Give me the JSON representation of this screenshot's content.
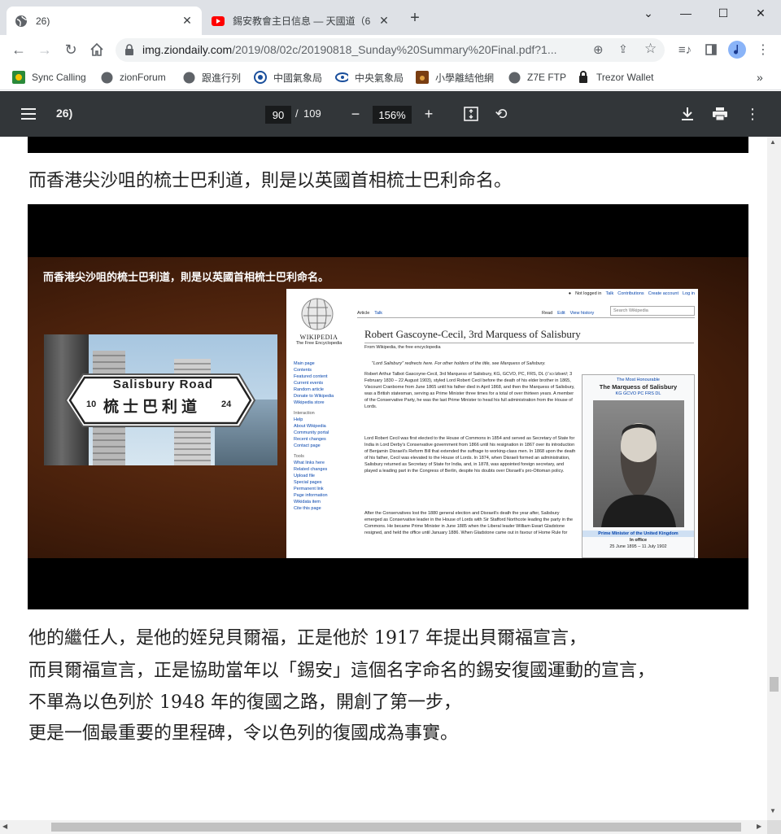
{
  "browser": {
    "tabs": [
      {
        "label": "26)",
        "active": true
      },
      {
        "label": "錫安教會主日信息 — 天國道（6",
        "active": false
      }
    ],
    "new_tab": "+",
    "url": {
      "host": "img.ziondaily.com",
      "path": "/2019/08/02c/20190818_Sunday%20Summary%20Final.pdf?1..."
    },
    "bookmarks": [
      "Sync Calling",
      "zionForum",
      "跟進行列",
      "中國氣象局",
      "中央氣象局",
      "小學離結他網",
      "Z7E FTP",
      "Trezor Wallet"
    ],
    "bookmarks_more": "»"
  },
  "pdf": {
    "title": "26)",
    "current_page": "90",
    "page_sep": "/",
    "total_pages": "109",
    "zoom": "156%"
  },
  "document": {
    "line_above_image": "而香港尖沙咀的梳士巴利道，則是以英國首相梳士巴利命名。",
    "paragraph": [
      "他的繼任人，是他的姪兒貝爾福，正是他於 1917 年提出貝爾福宣言，",
      "而貝爾福宣言，正是協助當年以「錫安」這個名字命名的錫安復國運動的宣言，",
      "不單為以色列於 1948 年的復國之路，開創了第一步，",
      "更是一個最重要的里程碑，令以色列的復國成為事實。"
    ]
  },
  "slide": {
    "caption": "而香港尖沙咀的梳士巴利道，則是以英國首相梳士巴利命名。",
    "sign": {
      "road": "Salisbury Road",
      "chinese": "梳士巴利道",
      "num_left": "10",
      "num_right": "24"
    },
    "wiki": {
      "user_links": [
        "Not logged in",
        "Talk",
        "Contributions",
        "Create account",
        "Log in"
      ],
      "tabs_left": [
        "Article",
        "Talk"
      ],
      "tabs_right": [
        "Read",
        "Edit",
        "View history"
      ],
      "search_placeholder": "Search Wikipedia",
      "logo_name": "WIKIPEDIA",
      "logo_tag": "The Free Encyclopedia",
      "title": "Robert Gascoyne-Cecil, 3rd Marquess of Salisbury",
      "from": "From Wikipedia, the free encyclopedia",
      "hatnote": "\"Lord Salisbury\" redirects here. For other holders of the title, see Marquess of Salisbury.",
      "nav1": [
        "Main page",
        "Contents",
        "Featured content",
        "Current events",
        "Random article",
        "Donate to Wikipedia",
        "Wikipedia store"
      ],
      "nav2_head": "Interaction",
      "nav2": [
        "Help",
        "About Wikipedia",
        "Community portal",
        "Recent changes",
        "Contact page"
      ],
      "nav3_head": "Tools",
      "nav3": [
        "What links here",
        "Related changes",
        "Upload file",
        "Special pages",
        "Permanent link",
        "Page information",
        "Wikidata item",
        "Cite this page"
      ],
      "para1": "Robert Arthur Talbot Gascoyne-Cecil, 3rd Marquess of Salisbury, KG, GCVO, PC, FRS, DL (/ˈsɔːlzbəri/; 3 February 1830 – 22 August 1903), styled Lord Robert Cecil before the death of his elder brother in 1865, Viscount Cranborne from June 1865 until his father died in April 1868, and then the Marquess of Salisbury, was a British statesman, serving as Prime Minister three times for a total of over thirteen years. A member of the Conservative Party, he was the last Prime Minister to head his full administration from the House of Lords.",
      "para2": "Lord Robert Cecil was first elected to the House of Commons in 1854 and served as Secretary of State for India in Lord Derby's Conservative government from 1866 until his resignation in 1867 over its introduction of Benjamin Disraeli's Reform Bill that extended the suffrage to working-class men. In 1868 upon the death of his father, Cecil was elevated to the House of Lords. In 1874, when Disraeli formed an administration, Salisbury returned as Secretary of State for India, and, in 1878, was appointed foreign secretary, and played a leading part in the Congress of Berlin, despite his doubts over Disraeli's pro-Ottoman policy.",
      "para3": "After the Conservatives lost the 1880 general election and Disraeli's death the year after, Salisbury emerged as Conservative leader in the House of Lords with Sir Stafford Northcote leading the party in the Commons. He became Prime Minister in June 1885 when the Liberal leader William Ewart Gladstone resigned, and held the office until January 1886. When Gladstone came out in favour of Home Rule for",
      "infobox_pre": "The Most Honourable",
      "infobox_name": "The Marquess of Salisbury",
      "infobox_post": "KG GCVO PC FRS DL",
      "infobox_office": "Prime Minister of the United Kingdom",
      "infobox_inoffice": "In office",
      "infobox_dates": "25 June 1895 – 11 July 1902"
    }
  }
}
